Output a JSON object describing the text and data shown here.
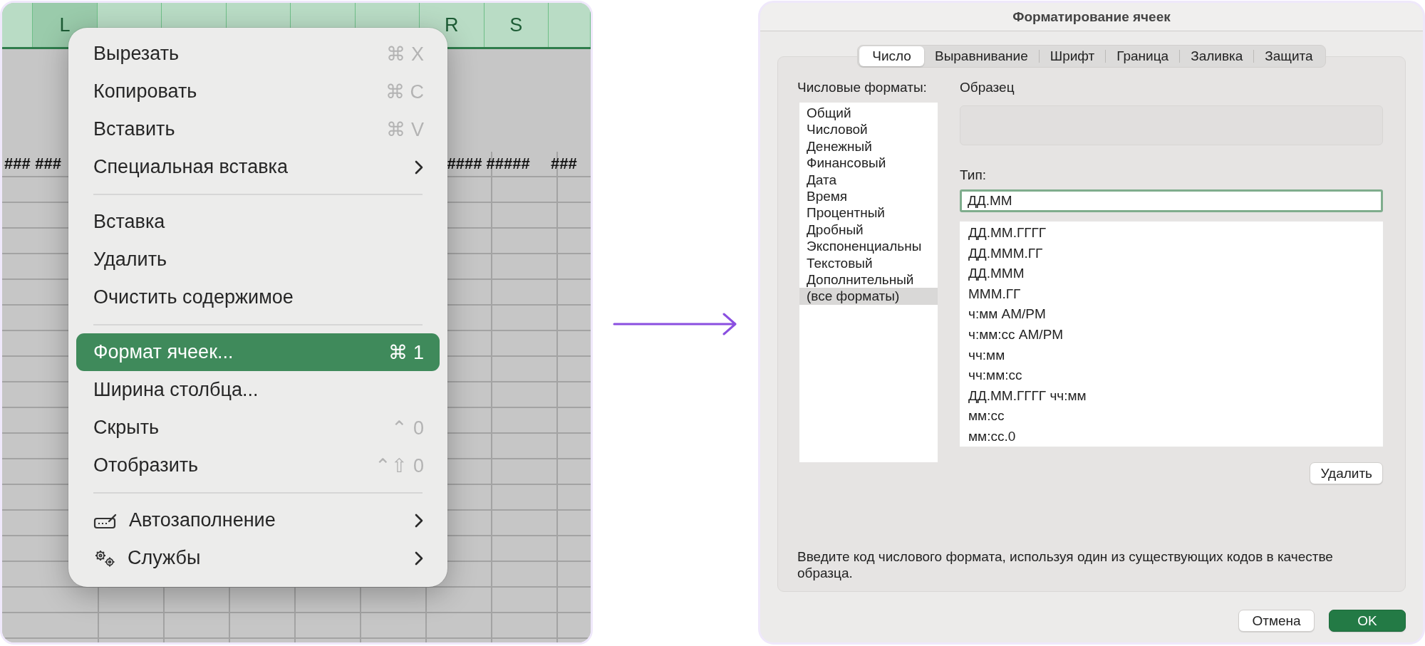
{
  "sheet": {
    "columns": [
      {
        "selected": false,
        "hash": "###"
      },
      {
        "label": "L",
        "selected": true,
        "hash": "###"
      },
      {
        "selected": false
      },
      {
        "selected": false
      },
      {
        "selected": false
      },
      {
        "selected": false
      },
      {
        "selected": false
      },
      {
        "label": "R",
        "selected": false,
        "hash": "####"
      },
      {
        "label": "S",
        "selected": false,
        "hash": "#####"
      },
      {
        "selected": false,
        "hash": "###"
      }
    ]
  },
  "context_menu": {
    "groups": [
      {
        "items": [
          {
            "label": "Вырезать",
            "shortcut": "⌘ X",
            "kind": "plain",
            "submenu": false,
            "selected": false
          },
          {
            "label": "Копировать",
            "shortcut": "⌘ C",
            "kind": "plain",
            "submenu": false,
            "selected": false
          },
          {
            "label": "Вставить",
            "shortcut": "⌘ V",
            "kind": "plain",
            "submenu": false,
            "selected": false
          },
          {
            "label": "Специальная вставка",
            "kind": "plain",
            "submenu": true,
            "selected": false
          }
        ]
      },
      {
        "items": [
          {
            "label": "Вставка",
            "kind": "plain",
            "submenu": false,
            "selected": false
          },
          {
            "label": "Удалить",
            "kind": "plain",
            "submenu": false,
            "selected": false
          },
          {
            "label": "Очистить содержимое",
            "kind": "plain",
            "submenu": false,
            "selected": false
          }
        ]
      },
      {
        "items": [
          {
            "label": "Формат ячеек...",
            "shortcut": "⌘ 1",
            "kind": "plain",
            "submenu": false,
            "selected": true
          },
          {
            "label": "Ширина столбца...",
            "kind": "plain",
            "submenu": false,
            "selected": false
          },
          {
            "label": "Скрыть",
            "shortcut": "⌃ 0",
            "kind": "plain",
            "submenu": false,
            "selected": false
          },
          {
            "label": "Отобразить",
            "shortcut": "⌃⇧ 0",
            "kind": "plain",
            "submenu": false,
            "selected": false
          }
        ]
      },
      {
        "items": [
          {
            "label": "Автозаполнение",
            "kind": "autofill",
            "submenu": true,
            "selected": false
          },
          {
            "label": "Службы",
            "kind": "services",
            "submenu": true,
            "selected": false
          }
        ]
      }
    ]
  },
  "dialog": {
    "title": "Форматирование ячеек",
    "tabs": [
      {
        "label": "Число",
        "selected": true
      },
      {
        "label": "Выравнивание",
        "selected": false
      },
      {
        "label": "Шрифт",
        "selected": false
      },
      {
        "label": "Граница",
        "selected": false
      },
      {
        "label": "Заливка",
        "selected": false
      },
      {
        "label": "Защита",
        "selected": false
      }
    ],
    "categories": {
      "label": "Числовые форматы:",
      "items": [
        {
          "label": "Общий",
          "selected": false
        },
        {
          "label": "Числовой",
          "selected": false
        },
        {
          "label": "Денежный",
          "selected": false
        },
        {
          "label": "Финансовый",
          "selected": false
        },
        {
          "label": "Дата",
          "selected": false
        },
        {
          "label": "Время",
          "selected": false
        },
        {
          "label": "Процентный",
          "selected": false
        },
        {
          "label": "Дробный",
          "selected": false
        },
        {
          "label": "Экспоненциальны",
          "selected": false
        },
        {
          "label": "Текстовый",
          "selected": false
        },
        {
          "label": "Дополнительный",
          "selected": false
        },
        {
          "label": "(все форматы)",
          "selected": true
        }
      ]
    },
    "sample": {
      "label": "Образец"
    },
    "type": {
      "label": "Тип:",
      "value": "ДД.ММ"
    },
    "formats": [
      {
        "label": "ДД.ММ.ГГГГ",
        "selected": false
      },
      {
        "label": "ДД.МММ.ГГ",
        "selected": false
      },
      {
        "label": "ДД.МММ",
        "selected": false
      },
      {
        "label": "МММ.ГГ",
        "selected": false
      },
      {
        "label": "ч:мм AM/PM",
        "selected": false
      },
      {
        "label": "ч:мм:сс AM/PM",
        "selected": false
      },
      {
        "label": "чч:мм",
        "selected": false
      },
      {
        "label": "чч:мм:сс",
        "selected": false
      },
      {
        "label": "ДД.ММ.ГГГГ чч:мм",
        "selected": false
      },
      {
        "label": "мм:сс",
        "selected": false
      },
      {
        "label": "мм:сс.0",
        "selected": false
      }
    ],
    "delete_button": "Удалить",
    "hint": "Введите код числового формата, используя один из существующих кодов в качестве образца.",
    "buttons": [
      {
        "label": "Отмена",
        "kind": "secondary"
      },
      {
        "label": "OK",
        "kind": "primary"
      }
    ]
  }
}
